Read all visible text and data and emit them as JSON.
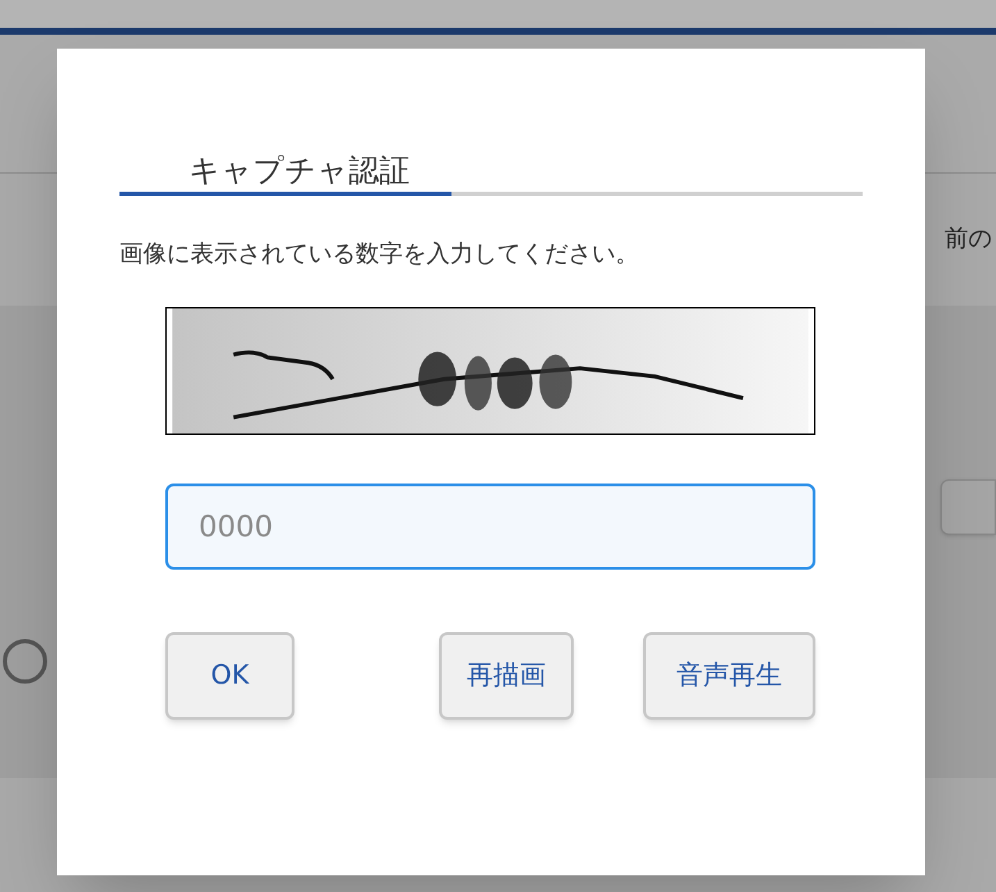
{
  "background": {
    "side_text": "前の",
    "radio": {
      "selected": false
    }
  },
  "dialog": {
    "tabs": [
      {
        "label": "キャプチャ認証",
        "selected": true
      }
    ],
    "instruction": "画像に表示されている数字を入力してください。",
    "input": {
      "placeholder": "0000"
    },
    "buttons": [
      "OK",
      "再描画",
      "音声再生"
    ]
  }
}
